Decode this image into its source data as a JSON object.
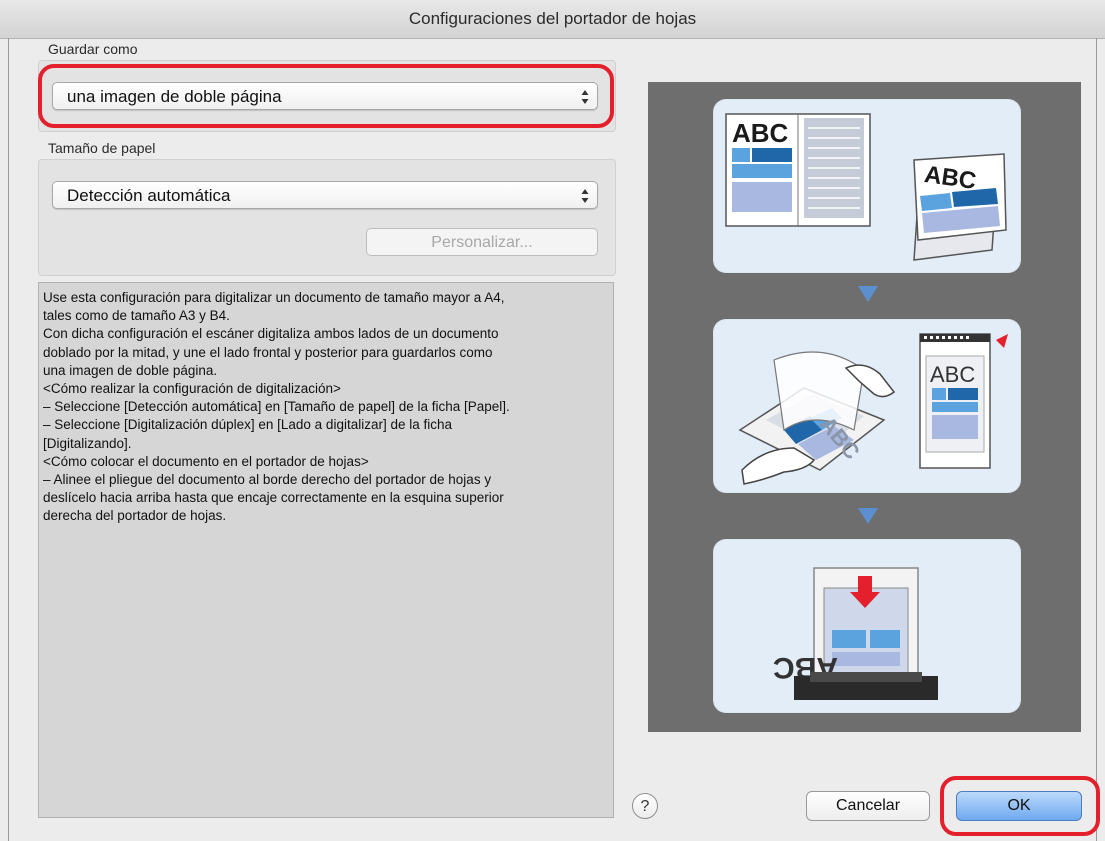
{
  "window": {
    "title": "Configuraciones del portador de hojas"
  },
  "save_as": {
    "label": "Guardar como",
    "selected": "una imagen de doble página"
  },
  "paper_size": {
    "label": "Tamaño de papel",
    "selected": "Detección automática",
    "customize_label": "Personalizar..."
  },
  "description": {
    "lines": [
      "Use esta configuración para digitalizar un documento de tamaño mayor a A4,",
      "tales como de tamaño A3 y B4.",
      "Con dicha configuración el escáner digitaliza ambos lados de un documento",
      "doblado por la mitad, y une el lado frontal y posterior para guardarlos como",
      "una imagen de doble página.",
      "",
      "<Cómo realizar la configuración de digitalización>",
      "– Seleccione [Detección automática] en [Tamaño de papel] de la ficha [Papel].",
      "– Seleccione [Digitalización dúplex] en [Lado a digitalizar] de la ficha",
      "[Digitalizando].",
      "",
      "<Cómo colocar el documento en el portador de hojas>",
      "– Alinee el pliegue del documento al borde derecho del portador de hojas y",
      "deslícelo hacia arriba hasta que encaje correctamente en la esquina superior",
      "derecha del portador de hojas."
    ]
  },
  "illustration": {
    "logo_text_1": "ABC",
    "logo_text_2": "ABC",
    "logo_text_3": "ABC",
    "logo_text_4": "ABC",
    "logo_text_5": "ABC"
  },
  "buttons": {
    "help": "?",
    "cancel": "Cancelar",
    "ok": "OK"
  },
  "colors": {
    "highlight": "#e3202b",
    "accent_blue": "#1f67a8",
    "card_bg": "#e3edf8",
    "arrow": "#5b8fd0"
  }
}
